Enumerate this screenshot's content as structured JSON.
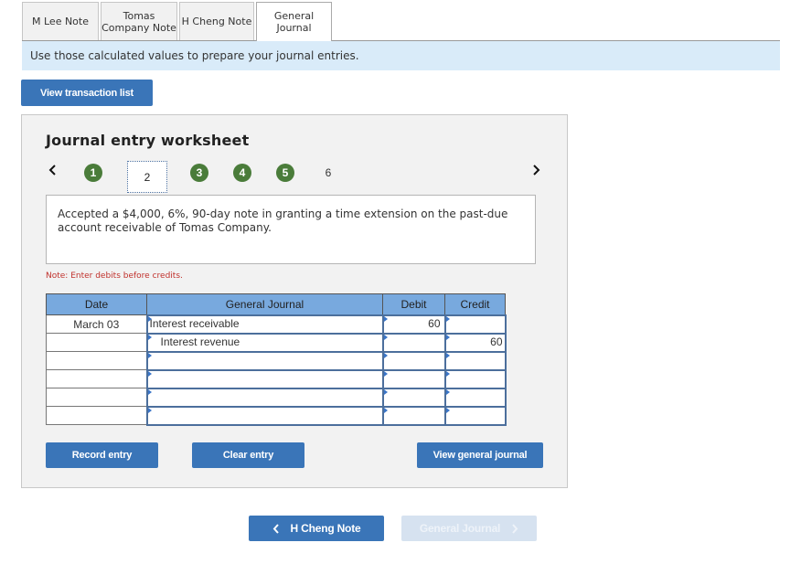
{
  "tabs": [
    {
      "label": "M Lee Note",
      "active": false
    },
    {
      "label": "Tomas Company Note",
      "line1": "Tomas",
      "line2": "Company Note",
      "active": false
    },
    {
      "label": "H Cheng Note",
      "active": false
    },
    {
      "label": "General Journal",
      "line1": "General",
      "line2": "Journal",
      "active": true
    }
  ],
  "instruction": "Use those calculated values to prepare your journal entries.",
  "view_transaction_list": "View transaction list",
  "worksheet": {
    "title": "Journal entry worksheet",
    "prev_icon": "chevron-left",
    "next_icon": "chevron-right",
    "steps": [
      {
        "label": "1",
        "state": "completed"
      },
      {
        "label": "2",
        "state": "current"
      },
      {
        "label": "3",
        "state": "completed"
      },
      {
        "label": "4",
        "state": "completed"
      },
      {
        "label": "5",
        "state": "completed"
      },
      {
        "label": "6",
        "state": "pending"
      }
    ],
    "description": "Accepted a $4,000, 6%, 90-day note in granting a time extension on the past-due account receivable of Tomas Company.",
    "note": "Note: Enter debits before credits.",
    "table": {
      "headers": [
        "Date",
        "General Journal",
        "Debit",
        "Credit"
      ],
      "rows": [
        {
          "date": "March 03",
          "account": "Interest receivable",
          "debit": "60",
          "credit": ""
        },
        {
          "date": "",
          "account": "Interest revenue",
          "debit": "",
          "credit": "60"
        },
        {
          "date": "",
          "account": "",
          "debit": "",
          "credit": ""
        },
        {
          "date": "",
          "account": "",
          "debit": "",
          "credit": ""
        },
        {
          "date": "",
          "account": "",
          "debit": "",
          "credit": ""
        },
        {
          "date": "",
          "account": "",
          "debit": "",
          "credit": ""
        }
      ]
    },
    "buttons": {
      "record": "Record entry",
      "clear": "Clear entry",
      "view_journal": "View general journal"
    }
  },
  "nav": {
    "prev_label": "H Cheng Note",
    "next_label": "General Journal",
    "next_disabled": true
  },
  "colors": {
    "primary_button": "#3a75b8",
    "step_complete": "#4a7c3a",
    "instruction_bg": "#d9ebf9",
    "table_header": "#78a9de",
    "note_text": "#c0302b"
  }
}
